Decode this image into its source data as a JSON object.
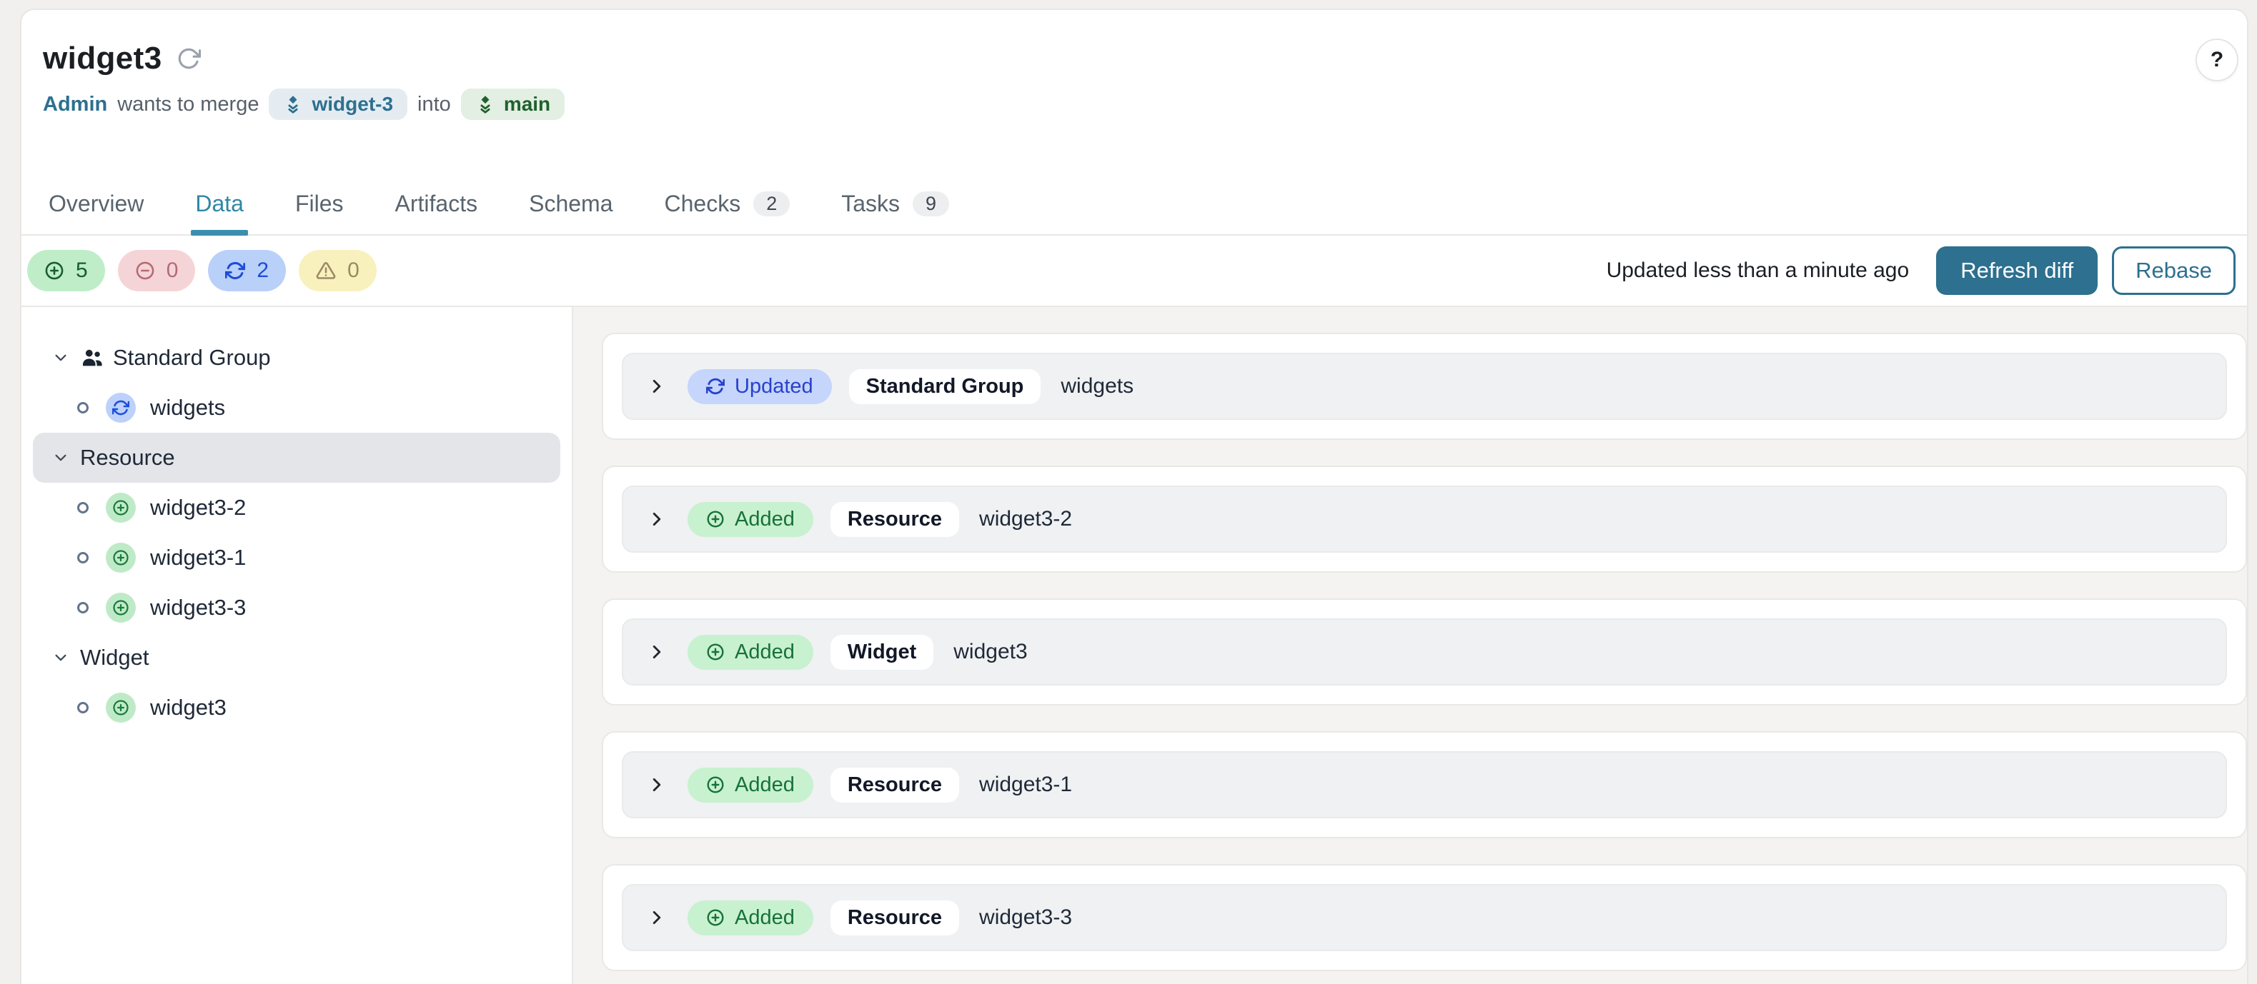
{
  "header": {
    "title": "widget3",
    "help_button": "?",
    "merge": {
      "author": "Admin",
      "action": "wants to merge",
      "source_branch": "widget-3",
      "preposition": "into",
      "target_branch": "main"
    }
  },
  "tabs": [
    {
      "label": "Overview"
    },
    {
      "label": "Data",
      "active": true
    },
    {
      "label": "Files"
    },
    {
      "label": "Artifacts"
    },
    {
      "label": "Schema"
    },
    {
      "label": "Checks",
      "badge": "2"
    },
    {
      "label": "Tasks",
      "badge": "9"
    }
  ],
  "toolbar": {
    "stats": [
      {
        "icon": "plus-circle",
        "value": "5",
        "kind": "added"
      },
      {
        "icon": "minus-circle",
        "value": "0",
        "kind": "removed"
      },
      {
        "icon": "refresh",
        "value": "2",
        "kind": "updated"
      },
      {
        "icon": "warning",
        "value": "0",
        "kind": "warning"
      }
    ],
    "updated_text": "Updated less than a minute ago",
    "refresh_diff_label": "Refresh diff",
    "rebase_label": "Rebase"
  },
  "sidebar": {
    "groups": [
      {
        "label": "Standard Group",
        "icon": "users",
        "children": [
          {
            "label": "widgets",
            "status": "updated"
          }
        ]
      },
      {
        "label": "Resource",
        "selected": true,
        "children": [
          {
            "label": "widget3-2",
            "status": "added"
          },
          {
            "label": "widget3-1",
            "status": "added"
          },
          {
            "label": "widget3-3",
            "status": "added"
          }
        ]
      },
      {
        "label": "Widget",
        "children": [
          {
            "label": "widget3",
            "status": "added"
          }
        ]
      }
    ]
  },
  "diff_rows": [
    {
      "status": "Updated",
      "kind": "updated",
      "type": "Standard Group",
      "name": "widgets"
    },
    {
      "status": "Added",
      "kind": "added",
      "type": "Resource",
      "name": "widget3-2"
    },
    {
      "status": "Added",
      "kind": "added",
      "type": "Widget",
      "name": "widget3"
    },
    {
      "status": "Added",
      "kind": "added",
      "type": "Resource",
      "name": "widget3-1"
    },
    {
      "status": "Added",
      "kind": "added",
      "type": "Resource",
      "name": "widget3-3"
    }
  ],
  "colors": {
    "accent_teal": "#2d708f",
    "tab_active": "#2f87a6",
    "added_green": "#17713a",
    "updated_blue": "#2941cc",
    "removed_red": "#b56b73",
    "warning_yellow": "#9b8a66",
    "panel_bg": "#f4f3f1",
    "selected_row": "#e3e5e9"
  }
}
